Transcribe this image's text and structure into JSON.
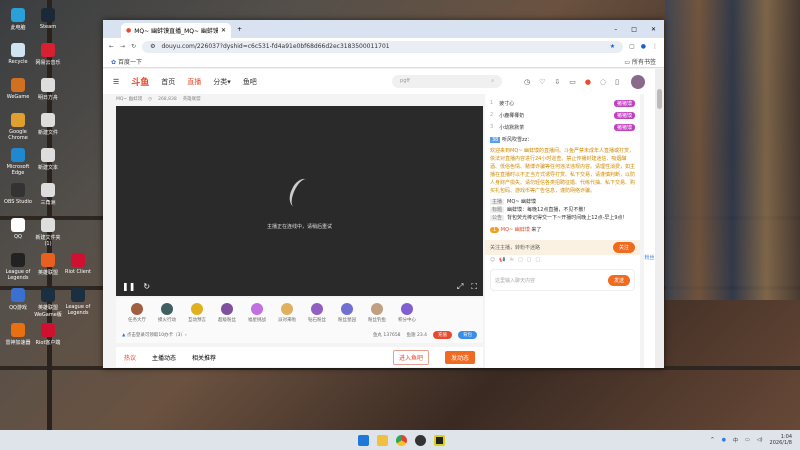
{
  "desktop": {
    "icons": [
      "此电脑",
      "Steam",
      "Recycle",
      "网易云音乐",
      "WeGame",
      "明日方舟",
      "Google Chrome",
      "新建文件",
      "Microsoft Edge",
      "新建文本",
      "OBS Studio",
      "三角洲",
      "QQ",
      "新建文件夹(1)",
      "League of Legends",
      "英雄联盟",
      "Riot Client",
      "QQ游戏",
      "英雄联盟WeGame版",
      "League of Legends",
      "雷神加速器",
      "Riot客户端"
    ]
  },
  "browser": {
    "tab_title": "MQ~ 幽蚌馍直播_MQ~ 幽蚌馍",
    "url": "douyu.com/226037?dyshid=c6c531-fd4a91e0bf68d66d2ec3183500011701",
    "bookmark": "百度一下",
    "all_bookmarks": "所有书签",
    "window_controls": [
      "–",
      "□",
      "✕"
    ]
  },
  "site": {
    "logo": "斗鱼",
    "nav": [
      "首页",
      "直播",
      "分类",
      "鱼吧"
    ],
    "search_placeholder": "pgff",
    "room": {
      "streamer": "MQ~ 幽蚌馍",
      "heat": "268,838",
      "tag": "英雄联盟"
    },
    "player": {
      "message": "主播正在连线中，请稍后重试"
    },
    "gifts": [
      "任务大厅",
      "摸火行动",
      "互动预言",
      "超级粉丝",
      "福星挑战",
      "派对来啦",
      "钻石粉丝",
      "粉丝星园",
      "粉丝钓鱼",
      "积分中心"
    ],
    "promo": "点击登录可领取10办卡（3）›",
    "fish_balls": "鱼丸 137658",
    "fish_fin": "鱼翅 23.4",
    "recharge": "充值",
    "backpack": "背包",
    "tabs": [
      "热议",
      "主播动态",
      "相关推荐"
    ],
    "enter_bar": "进入鱼吧",
    "post": "发动态"
  },
  "chat": {
    "rank": [
      {
        "n": "1",
        "name": "疲寸心",
        "badge": "猪猪馍"
      },
      {
        "n": "2",
        "name": "小鹿椰椰奶",
        "badge": "猪猪馍"
      },
      {
        "n": "3",
        "name": "小幼默默茶",
        "badge": "猪猪馍"
      }
    ],
    "user_line": "听风吹雪zz：",
    "welcome": "欢迎来到MQ~ 幽蚌馍的直播间。斗鱼严禁未成年人直播或打赏，依法对直播内容进行24小时巡查。禁止传播封建迷信、吸烟酗酒、低俗色情、赌博诈骗等任何违法违规内容。请理性消费，如主播在直播时以不正当方式诱导打赏、私下交易，请谨慎判断，以防人身财产损失。请勿轻信各类招聘征婚、代练代抽、私下交易、购买礼包码、游戏币等广告信息，谨防网络诈骗。",
    "streamer_label": "主播",
    "streamer": "MQ~ 幽蚌馍",
    "title_label": "标题",
    "title": "幽蚌馍：每晚12点直播，不见不散！",
    "notice_label": "公告",
    "notice": "背包荧光棒记得交一下~开播时间晚上12点-早上9点！",
    "enter": "MQ~ 幽蚌馍",
    "enter_suffix": "来了",
    "follow_text": "关注主播，转粉不迷路",
    "follow": "关注",
    "input_placeholder": "这里输入聊天内容",
    "send": "发送"
  },
  "side": [
    "粉丝"
  ],
  "taskbar": {
    "time": "1:04",
    "date": "2026/1/8",
    "ime": "中"
  }
}
